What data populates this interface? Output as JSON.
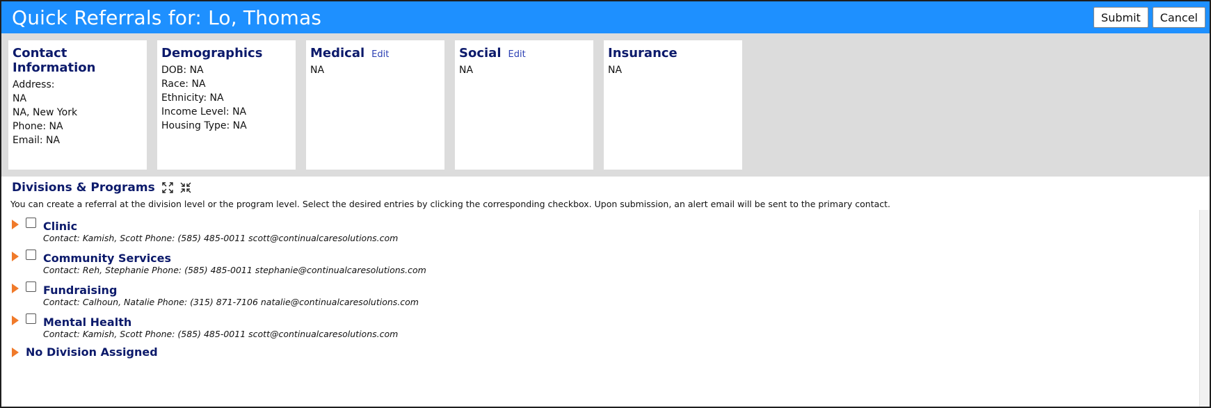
{
  "header": {
    "title": "Quick Referrals for: Lo, Thomas",
    "submit_label": "Submit",
    "cancel_label": "Cancel"
  },
  "cards": {
    "contact": {
      "title": "Contact Information",
      "lines": [
        "Address:",
        "NA",
        "NA, New York",
        "Phone: NA",
        "Email: NA"
      ]
    },
    "demographics": {
      "title": "Demographics",
      "lines": [
        "DOB: NA",
        "Race: NA",
        "Ethnicity: NA",
        "Income Level: NA",
        "Housing Type: NA"
      ]
    },
    "medical": {
      "title": "Medical",
      "edit_label": "Edit",
      "lines": [
        "NA"
      ]
    },
    "social": {
      "title": "Social",
      "edit_label": "Edit",
      "lines": [
        "NA"
      ]
    },
    "insurance": {
      "title": "Insurance",
      "lines": [
        "NA"
      ]
    }
  },
  "divisions": {
    "title": "Divisions & Programs",
    "expand_icon": "expand-icon",
    "collapse_icon": "collapse-icon",
    "help_text": "You can create a referral at the division level or the program level. Select the desired entries by clicking the corresponding checkbox. Upon submission, an alert email will be sent to the primary contact.",
    "items": [
      {
        "name": "Clinic",
        "contact": "Contact: Kamish, Scott Phone: (585) 485-0011 scott@continualcaresolutions.com"
      },
      {
        "name": "Community Services",
        "contact": "Contact: Reh, Stephanie Phone: (585) 485-0011 stephanie@continualcaresolutions.com"
      },
      {
        "name": "Fundraising",
        "contact": "Contact: Calhoun, Natalie Phone: (315) 871-7106 natalie@continualcaresolutions.com"
      },
      {
        "name": "Mental Health",
        "contact": "Contact: Kamish, Scott Phone: (585) 485-0011 scott@continualcaresolutions.com"
      }
    ],
    "no_division_label": "No Division Assigned"
  },
  "colors": {
    "header_bg": "#1e90ff",
    "heading_text": "#0c1a6b",
    "caret": "#f07a2a",
    "band_bg": "#dcdcdc"
  }
}
